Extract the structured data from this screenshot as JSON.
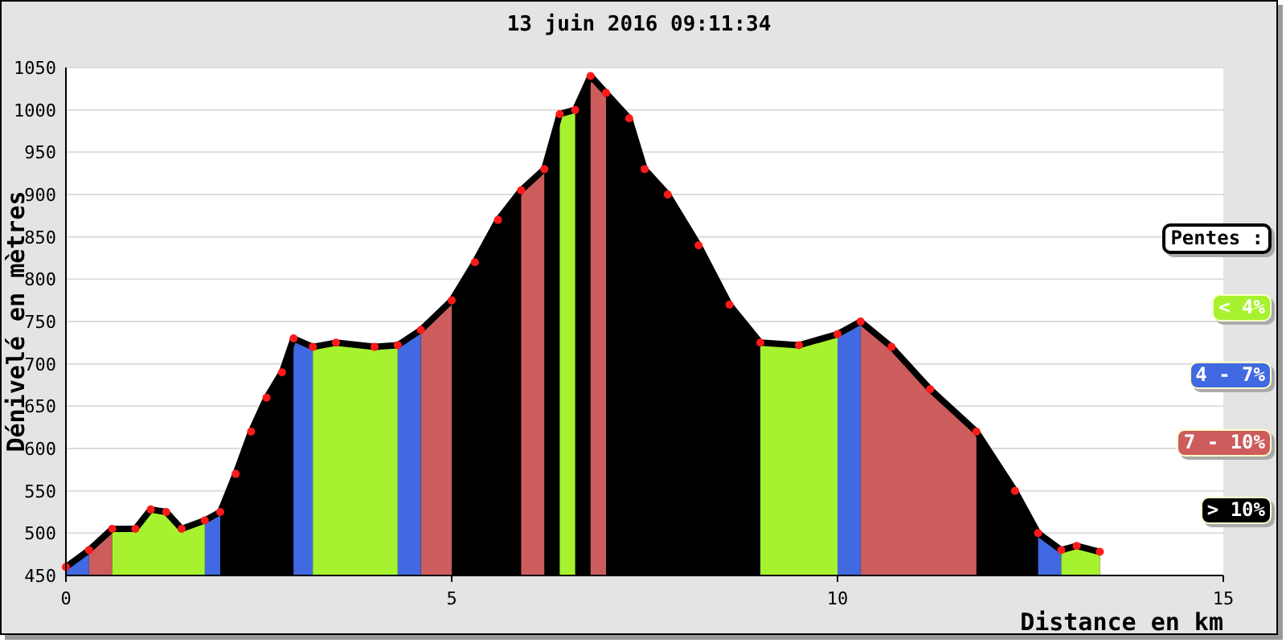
{
  "title": "13 juin 2016 09:11:34",
  "chart": {
    "chart_data": {
      "type": "area",
      "xlabel": "Distance en km",
      "ylabel": "Dénivelé en mètres",
      "x": [
        0,
        0.3,
        0.6,
        0.9,
        1.1,
        1.3,
        1.5,
        1.8,
        2.0,
        2.2,
        2.4,
        2.6,
        2.8,
        2.95,
        3.2,
        3.5,
        4.0,
        4.3,
        4.6,
        5.0,
        5.3,
        5.6,
        5.9,
        6.2,
        6.4,
        6.6,
        6.8,
        7.0,
        7.3,
        7.5,
        7.8,
        8.2,
        8.6,
        9.0,
        9.5,
        10.0,
        10.3,
        10.7,
        11.2,
        11.8,
        12.3,
        12.6,
        12.9,
        13.1,
        13.4
      ],
      "grid": true,
      "series": [
        {
          "name": "< 4%",
          "color": "#a6f22e",
          "values": [
            null,
            null,
            505,
            505,
            528,
            525,
            505,
            515,
            null,
            null,
            null,
            null,
            null,
            null,
            720,
            725,
            720,
            722,
            null,
            null,
            null,
            null,
            null,
            null,
            995,
            1000,
            null,
            null,
            null,
            null,
            null,
            null,
            null,
            725,
            722,
            735,
            null,
            null,
            null,
            null,
            null,
            null,
            480,
            485,
            478
          ]
        },
        {
          "name": "4 - 7%",
          "color": "#4169e1",
          "values": [
            460,
            480,
            null,
            null,
            null,
            null,
            null,
            515,
            525,
            null,
            null,
            null,
            null,
            730,
            720,
            null,
            null,
            722,
            740,
            null,
            null,
            null,
            null,
            null,
            null,
            null,
            null,
            null,
            null,
            null,
            null,
            null,
            null,
            null,
            null,
            735,
            750,
            null,
            null,
            null,
            null,
            500,
            480,
            null,
            null
          ]
        },
        {
          "name": "7 - 10%",
          "color": "#cd5c5c",
          "values": [
            null,
            480,
            505,
            null,
            null,
            null,
            null,
            null,
            null,
            null,
            null,
            null,
            null,
            null,
            null,
            null,
            null,
            null,
            740,
            775,
            null,
            null,
            905,
            930,
            null,
            null,
            1040,
            1020,
            null,
            null,
            null,
            null,
            null,
            null,
            null,
            null,
            750,
            720,
            670,
            620,
            null,
            null,
            null,
            null,
            null
          ]
        },
        {
          "name": "> 10%",
          "color": "#000000",
          "values": [
            460,
            480,
            505,
            505,
            528,
            525,
            505,
            515,
            525,
            570,
            620,
            660,
            690,
            730,
            720,
            725,
            720,
            722,
            740,
            775,
            820,
            870,
            905,
            930,
            995,
            1000,
            1040,
            1020,
            990,
            930,
            900,
            840,
            770,
            725,
            722,
            735,
            750,
            720,
            670,
            620,
            550,
            500,
            480,
            485,
            478
          ]
        }
      ],
      "xlim": [
        0,
        15
      ],
      "ylim": [
        450,
        1050
      ],
      "xticks": [
        0,
        5,
        10,
        15
      ],
      "yticks": [
        450,
        500,
        550,
        600,
        650,
        700,
        750,
        800,
        850,
        900,
        950,
        1000,
        1050
      ]
    }
  },
  "legend": {
    "title": "Pentes :"
  }
}
